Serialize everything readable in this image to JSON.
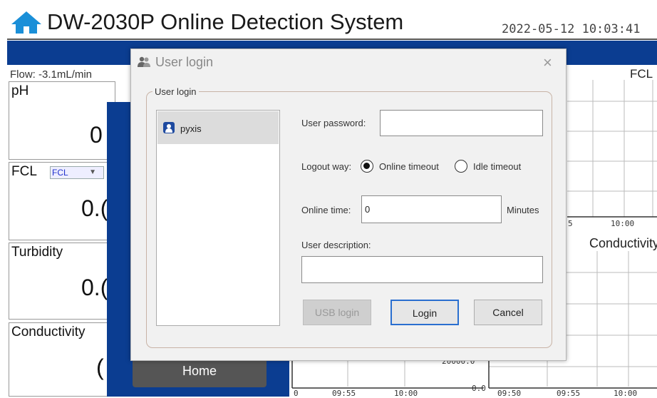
{
  "header": {
    "title": "DW-2030P Online Detection System",
    "datetime": "2022-05-12 10:03:41"
  },
  "status": {
    "flow": "Flow: -3.1mL/min",
    "fcl_chart_label": "FCL"
  },
  "panels": {
    "ph": {
      "title": "pH",
      "value": "0"
    },
    "fcl": {
      "title": "FCL",
      "value": "0.(",
      "select_value": "FCL"
    },
    "turbidity": {
      "title": "Turbidity",
      "value": "0.("
    },
    "conductivity": {
      "title": "Conductivity",
      "value": "("
    }
  },
  "home": {
    "button_label": "Home"
  },
  "charts": {
    "top_ticks": [
      "5",
      "10:00"
    ],
    "conductivity_title": "Conductivity",
    "bottom_ticks_left": [
      "0",
      "09:55",
      "10:00"
    ],
    "bottom_ticks_right": [
      "09:50",
      "09:55",
      "10:00"
    ],
    "y_min_label": "0.0",
    "y_partial_label": "20000.0"
  },
  "login_dialog": {
    "title": "User login",
    "close_glyph": "×",
    "group_label": "User login",
    "users": [
      {
        "name": "pyxis"
      }
    ],
    "password_label": "User password:",
    "password_value": "",
    "logout_label": "Logout way:",
    "logout_options": [
      {
        "label": "Online timeout",
        "selected": true
      },
      {
        "label": "Idle timeout",
        "selected": false
      }
    ],
    "online_time_label": "Online time:",
    "online_time_value": "0",
    "minutes_label": "Minutes",
    "description_label": "User description:",
    "description_value": "",
    "buttons": {
      "usb": "USB login",
      "login": "Login",
      "cancel": "Cancel"
    }
  },
  "colors": {
    "brand_blue": "#0b3d91",
    "home_icon": "#1a8fd8",
    "focus_border": "#2a6fd0"
  },
  "icons": {
    "home": "home-icon",
    "dialog": "users-icon",
    "user": "user-avatar-icon",
    "close": "close-icon"
  }
}
